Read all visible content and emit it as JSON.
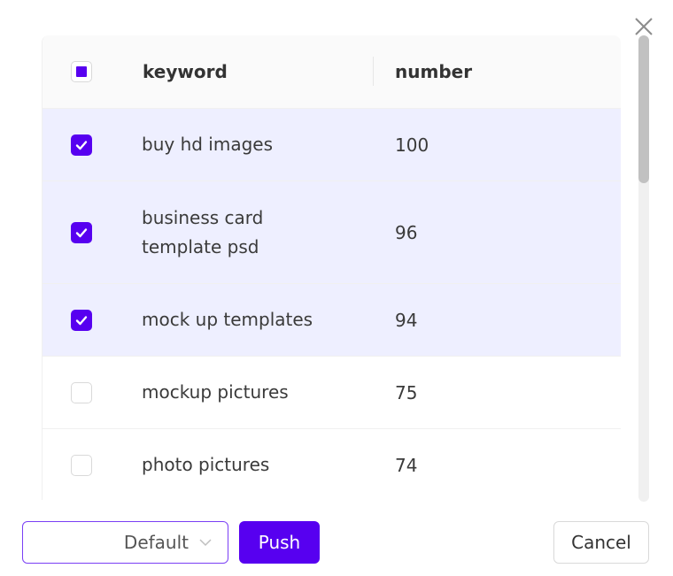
{
  "dialog": {
    "close_icon": "close-icon"
  },
  "table": {
    "headers": {
      "keyword": "keyword",
      "number": "number"
    },
    "header_checkbox_state": "indeterminate",
    "rows": [
      {
        "keyword": "buy hd images",
        "number": "100",
        "checked": true
      },
      {
        "keyword": "business card template psd",
        "number": "96",
        "checked": true
      },
      {
        "keyword": "mock up templates",
        "number": "94",
        "checked": true
      },
      {
        "keyword": "mockup pictures",
        "number": "75",
        "checked": false
      },
      {
        "keyword": "photo pictures",
        "number": "74",
        "checked": false
      }
    ]
  },
  "footer": {
    "select_value": "Default",
    "push_label": "Push",
    "cancel_label": "Cancel"
  },
  "colors": {
    "accent": "#5700f0",
    "selected_row": "#eeefff",
    "header_bg": "#fafafa"
  }
}
